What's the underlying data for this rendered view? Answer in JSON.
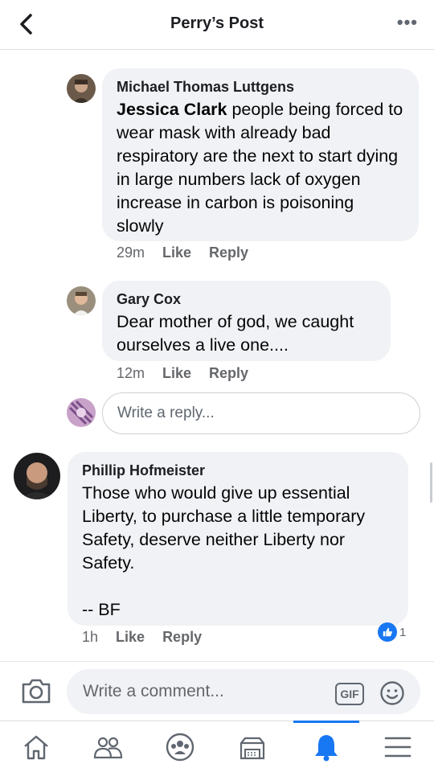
{
  "header": {
    "title": "Perry’s Post",
    "more": "•••"
  },
  "comments": [
    {
      "author": "Michael Thomas Luttgens",
      "mention": "Jessica Clark",
      "text": " people being forced to wear mask with already bad respiratory are the next to start dying in large numbers lack of oxygen increase in carbon is poisoning slowly",
      "time": "29m",
      "like": "Like",
      "reply": "Reply"
    },
    {
      "author": "Gary Cox",
      "text": "Dear mother of god, we caught ourselves a live one....",
      "time": "12m",
      "like": "Like",
      "reply": "Reply"
    },
    {
      "author": "Phillip Hofmeister",
      "text": "Those who would give up essential Liberty, to purchase a little temporary Safety, deserve neither Liberty nor Safety.\n\n-- BF",
      "time": "1h",
      "like": "Like",
      "reply": "Reply",
      "reactions": "1"
    }
  ],
  "reply_box": {
    "placeholder": "Write a reply..."
  },
  "composer": {
    "placeholder": "Write a comment...",
    "gif_label": "GIF"
  },
  "icons": {
    "back": "chevron-left-icon",
    "more": "more-icon",
    "camera": "camera-icon",
    "emoji": "smiley-icon",
    "home": "home-icon",
    "friends": "friends-icon",
    "groups": "groups-icon",
    "marketplace": "marketplace-icon",
    "notifications": "bell-icon",
    "menu": "menu-icon",
    "like": "thumbs-up-icon"
  },
  "colors": {
    "accent": "#1877f2",
    "bubble": "#f0f2f5",
    "secondary_text": "#65676b"
  }
}
